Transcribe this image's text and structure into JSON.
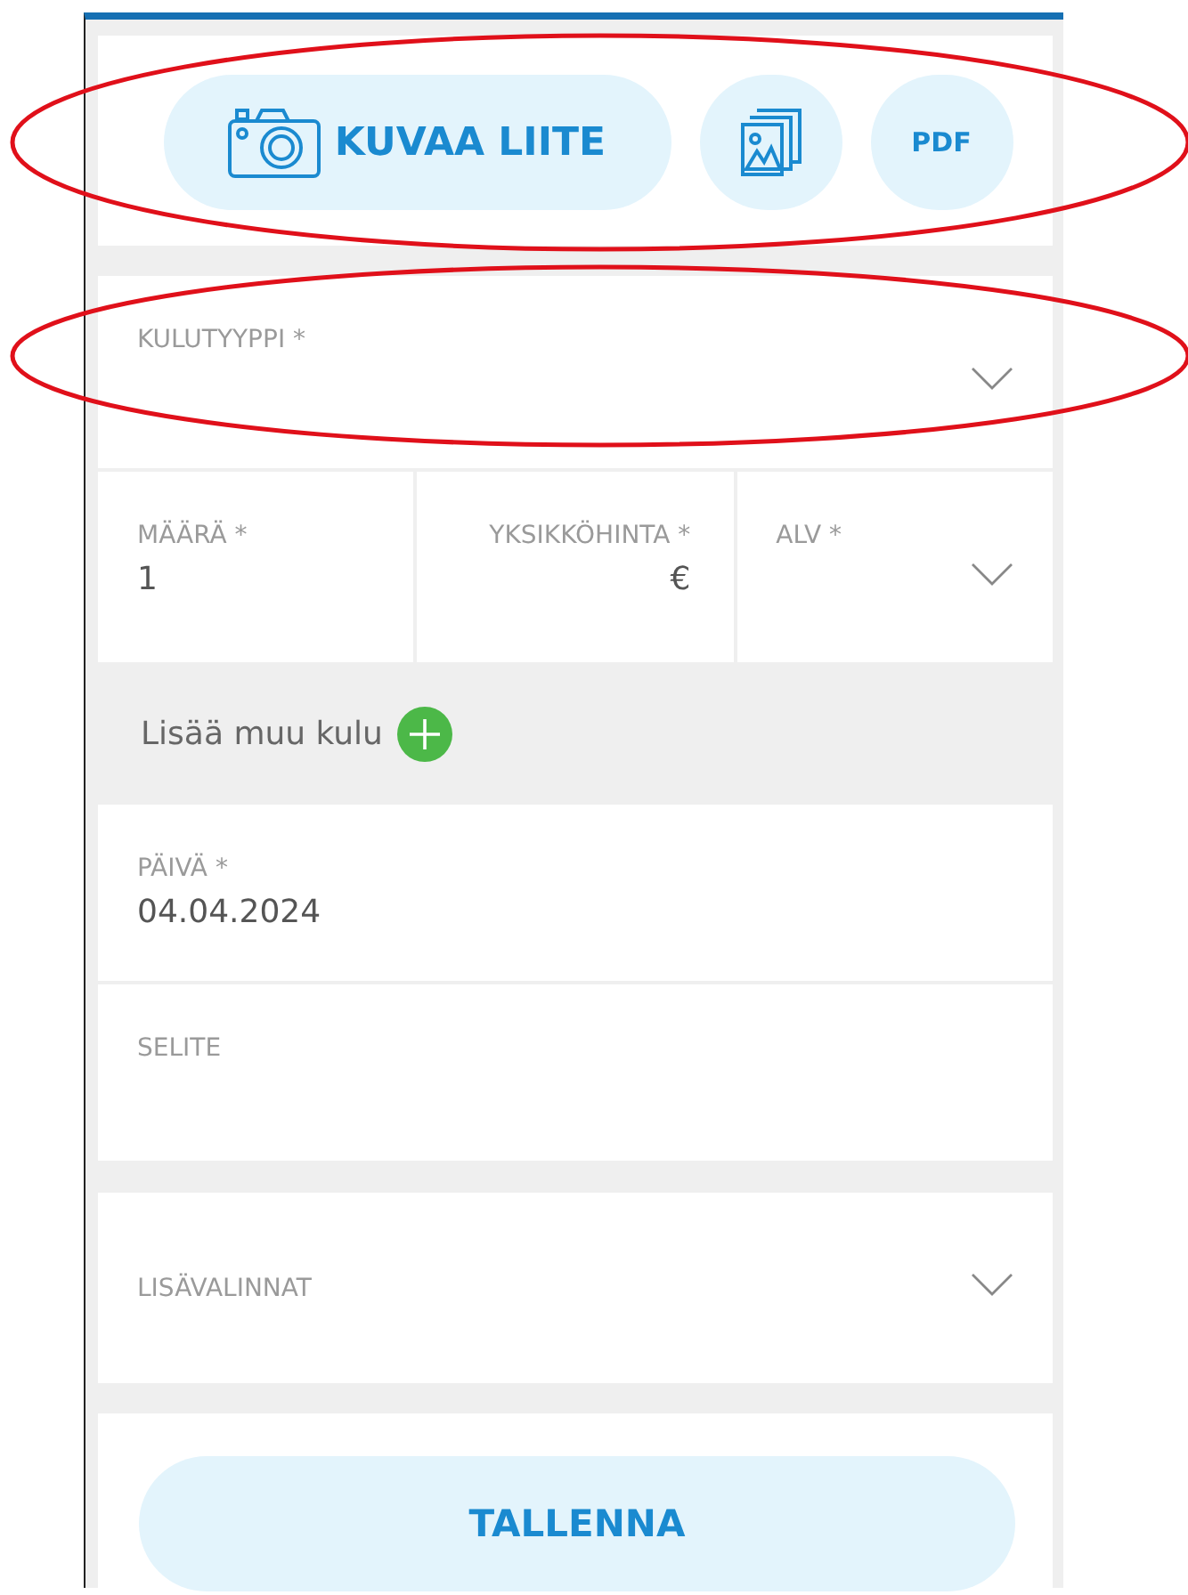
{
  "attachments": [
    {
      "kind": "camera",
      "label": "KUVAA LIITE"
    },
    {
      "kind": "gallery"
    },
    {
      "kind": "pdf",
      "label": "PDF"
    }
  ],
  "expense_type": {
    "kind": "dropdown",
    "label": "KULUTYYPPI *"
  },
  "line_fields": [
    {
      "kind": "text",
      "label": "MÄÄRÄ *",
      "value": "1"
    },
    {
      "kind": "price",
      "label": "YKSIKKÖHINTA *",
      "value": "€"
    },
    {
      "kind": "dropdown",
      "label": "ALV *"
    }
  ],
  "add_expense": {
    "label": "Lisää muu kulu"
  },
  "details": [
    {
      "kind": "text",
      "label": "PÄIVÄ *",
      "value": "04.04.2024"
    },
    {
      "kind": "text",
      "label": "SELITE"
    }
  ],
  "more_options": {
    "label": "LISÄVALINNAT",
    "expanded": false
  },
  "save_button": {
    "label": "TALLENNA"
  },
  "annotations": [
    {
      "kind": "ellipse"
    },
    {
      "kind": "ellipse"
    }
  ]
}
